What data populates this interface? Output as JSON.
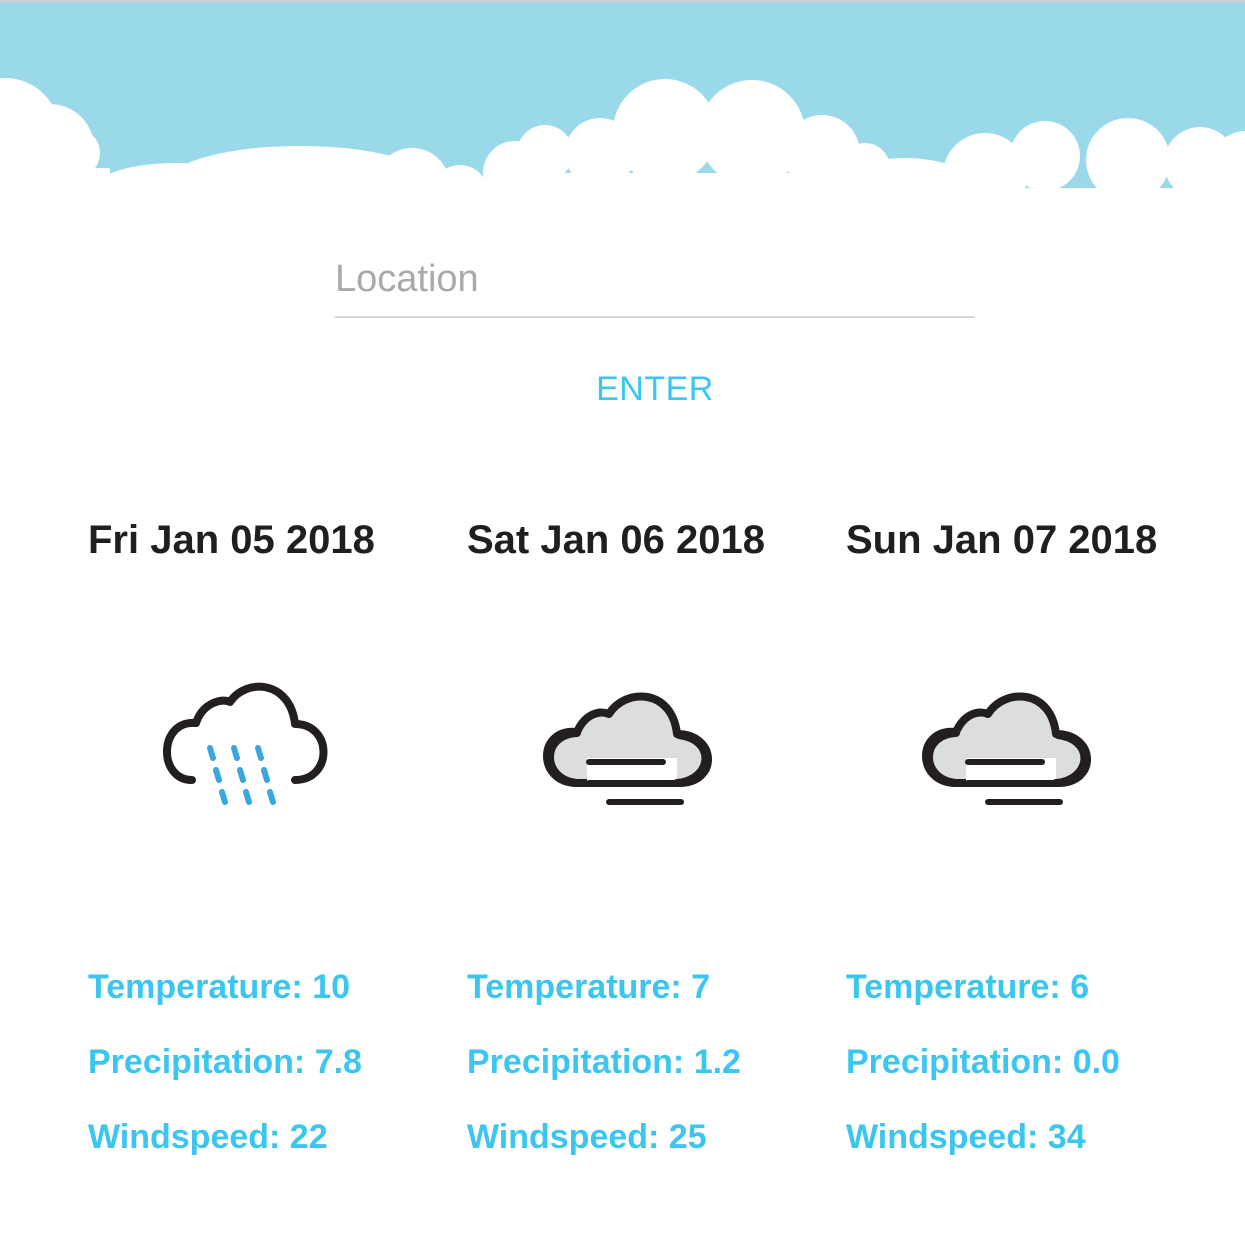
{
  "search": {
    "value": "",
    "placeholder": "Location",
    "button_label": "ENTER"
  },
  "colors": {
    "sky": "#9ad9e9",
    "accent": "#3cc6ef",
    "heading": "#1f1f1f"
  },
  "forecast": [
    {
      "date": "Fri Jan 05 2018",
      "icon": "rain-cloud-icon",
      "temperature_text": "Temperature: 10",
      "precipitation_text": "Precipitation: 7.8",
      "windspeed_text": "Windspeed: 22"
    },
    {
      "date": "Sat Jan 06 2018",
      "icon": "fog-cloud-icon",
      "temperature_text": "Temperature: 7",
      "precipitation_text": "Precipitation: 1.2",
      "windspeed_text": "Windspeed: 25"
    },
    {
      "date": "Sun Jan 07 2018",
      "icon": "fog-cloud-icon",
      "temperature_text": "Temperature: 6",
      "precipitation_text": "Precipitation: 0.0",
      "windspeed_text": "Windspeed: 34"
    }
  ]
}
